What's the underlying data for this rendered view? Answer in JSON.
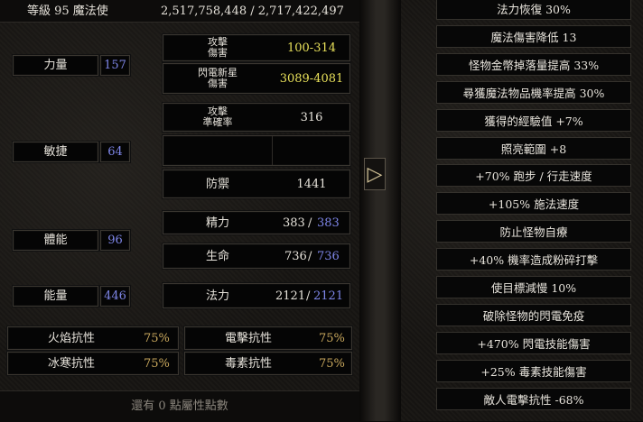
{
  "header": {
    "level_class": "等級 95 魔法使",
    "experience": "2,517,758,448 / 2,717,422,497"
  },
  "attributes": {
    "strength": {
      "label": "力量",
      "value": "157"
    },
    "dexterity": {
      "label": "敏捷",
      "value": "64"
    },
    "vitality": {
      "label": "體能",
      "value": "96"
    },
    "energy": {
      "label": "能量",
      "value": "446"
    }
  },
  "combat": {
    "attack_damage_label_1": "攻擊",
    "attack_damage_label_2": "傷害",
    "attack_damage": "100-314",
    "lightning_damage_label_1": "閃電新星",
    "lightning_damage_label_2": "傷害",
    "lightning_damage": "3089-4081",
    "attack_rating_label_1": "攻擊",
    "attack_rating_label_2": "準確率",
    "attack_rating": "316",
    "defense_label": "防禦",
    "defense": "1441"
  },
  "vitals": {
    "stamina_label": "精力",
    "stamina_current": "383",
    "stamina_max": "383",
    "life_label": "生命",
    "life_current": "736",
    "life_max": "736",
    "mana_label": "法力",
    "mana_current": "2121",
    "mana_max": "2121",
    "separator": "/"
  },
  "resistances": {
    "fire_label": "火焰抗性",
    "fire": "75%",
    "lightning_label": "電擊抗性",
    "lightning": "75%",
    "cold_label": "冰寒抗性",
    "cold": "75%",
    "poison_label": "毒素抗性",
    "poison": "75%"
  },
  "footer": {
    "remaining_points": "還有 0 點屬性點數"
  },
  "nav": {
    "toggle_arrow": "▷"
  },
  "advanced_stats": [
    "法力恢復 30%",
    "魔法傷害降低 13",
    "怪物金幣掉落量提高 33%",
    "尋獲魔法物品機率提高 30%",
    "獲得的經驗值 +7%",
    "照亮範圍 +8",
    "+70% 跑步 / 行走速度",
    "+105% 施法速度",
    "防止怪物自療",
    "+40% 機率造成粉碎打擊",
    "使目標減慢 10%",
    "破除怪物的閃電免疫",
    "+470% 閃電技能傷害",
    "+25% 毒素技能傷害",
    "敵人電擊抗性 -68%"
  ],
  "colors": {
    "max_value_blue": "#7e86e8",
    "damage_yellow": "#e8e05a",
    "resist_gold": "#c9a85d"
  }
}
